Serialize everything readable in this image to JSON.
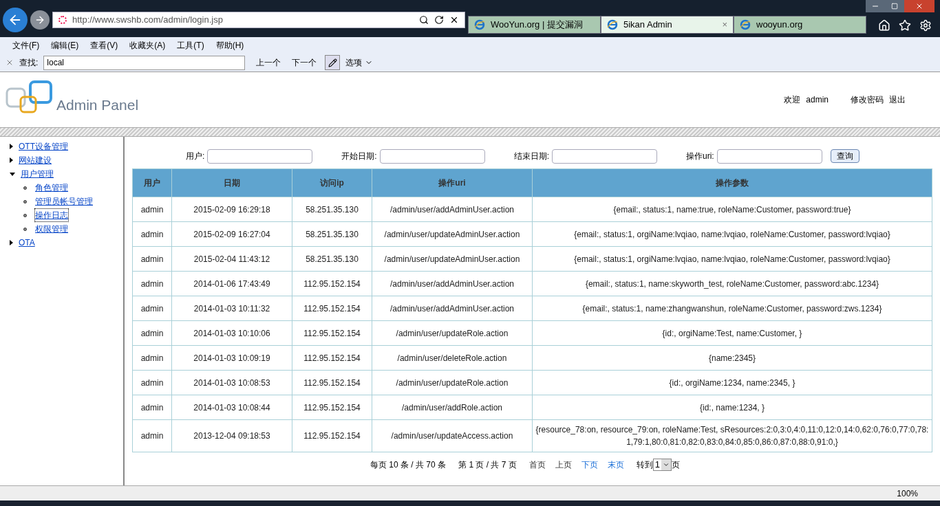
{
  "browser": {
    "address": "http://www.swshb.com/admin/login.jsp",
    "tabs": [
      {
        "label": "WooYun.org | 提交漏洞",
        "selected": false
      },
      {
        "label": "5ikan Admin",
        "selected": true,
        "close": "×"
      },
      {
        "label": "wooyun.org",
        "selected": false
      }
    ],
    "menu": [
      "文件(F)",
      "编辑(E)",
      "查看(V)",
      "收藏夹(A)",
      "工具(T)",
      "帮助(H)"
    ],
    "find_bar": {
      "label": "查找:",
      "value": "local",
      "prev": "上一个",
      "next": "下一个",
      "options": "选项"
    },
    "status_bar": {
      "zoom": "100%"
    }
  },
  "header": {
    "title": "Admin Panel",
    "welcome": "欢迎",
    "user": "admin",
    "links": [
      "修改密码",
      "退出"
    ]
  },
  "sidebar": {
    "items": [
      {
        "label": "OTT设备管理",
        "expanded": false
      },
      {
        "label": "网站建设",
        "expanded": false
      },
      {
        "label": "用户管理",
        "expanded": true,
        "children": [
          {
            "label": "角色管理",
            "selected": false
          },
          {
            "label": "管理员帐号管理",
            "selected": false
          },
          {
            "label": "操作日志",
            "selected": true
          },
          {
            "label": "权限管理",
            "selected": false
          }
        ]
      },
      {
        "label": "OTA",
        "expanded": false
      }
    ]
  },
  "filters": [
    {
      "label": "用户:"
    },
    {
      "label": "开始日期:"
    },
    {
      "label": "结束日期:"
    },
    {
      "label": "操作uri:"
    }
  ],
  "search_button": "查询",
  "table": {
    "columns": [
      "用户",
      "日期",
      "访问ip",
      "操作uri",
      "操作参数"
    ],
    "rows": [
      [
        "admin",
        "2015-02-09 16:29:18",
        "58.251.35.130",
        "/admin/user/addAdminUser.action",
        "{email:, status:1, name:true, roleName:Customer, password:true}"
      ],
      [
        "admin",
        "2015-02-09 16:27:04",
        "58.251.35.130",
        "/admin/user/updateAdminUser.action",
        "{email:, status:1, orgiName:lvqiao, name:lvqiao, roleName:Customer, password:lvqiao}"
      ],
      [
        "admin",
        "2015-02-04 11:43:12",
        "58.251.35.130",
        "/admin/user/updateAdminUser.action",
        "{email:, status:1, orgiName:lvqiao, name:lvqiao, roleName:Customer, password:lvqiao}"
      ],
      [
        "admin",
        "2014-01-06 17:43:49",
        "112.95.152.154",
        "/admin/user/addAdminUser.action",
        "{email:, status:1, name:skyworth_test, roleName:Customer, password:abc.1234}"
      ],
      [
        "admin",
        "2014-01-03 10:11:32",
        "112.95.152.154",
        "/admin/user/addAdminUser.action",
        "{email:, status:1, name:zhangwanshun, roleName:Customer, password:zws.1234}"
      ],
      [
        "admin",
        "2014-01-03 10:10:06",
        "112.95.152.154",
        "/admin/user/updateRole.action",
        "{id:, orgiName:Test, name:Customer, }"
      ],
      [
        "admin",
        "2014-01-03 10:09:19",
        "112.95.152.154",
        "/admin/user/deleteRole.action",
        "{name:2345}"
      ],
      [
        "admin",
        "2014-01-03 10:08:53",
        "112.95.152.154",
        "/admin/user/updateRole.action",
        "{id:, orgiName:1234, name:2345, }"
      ],
      [
        "admin",
        "2014-01-03 10:08:44",
        "112.95.152.154",
        "/admin/user/addRole.action",
        "{id:, name:1234, }"
      ],
      [
        "admin",
        "2013-12-04 09:18:53",
        "112.95.152.154",
        "/admin/user/updateAccess.action",
        "{resource_78:on, resource_79:on, roleName:Test, sResources:2:0,3:0,4:0,11:0,12:0,14:0,62:0,76:0,77:0,78:1,79:1,80:0,81:0,82:0,83:0,84:0,85:0,86:0,87:0,88:0,91:0,}"
      ]
    ]
  },
  "pagination": {
    "summary": "每页 10 条 / 共 70 条",
    "page_info": "第 1 页 / 共 7 页",
    "links": [
      {
        "label": "首页",
        "disabled": true
      },
      {
        "label": "上页",
        "disabled": true
      },
      {
        "label": "下页",
        "disabled": false
      },
      {
        "label": "末页",
        "disabled": false
      }
    ],
    "goto_label": "转到",
    "page_value": "1",
    "page_suffix": "页"
  }
}
